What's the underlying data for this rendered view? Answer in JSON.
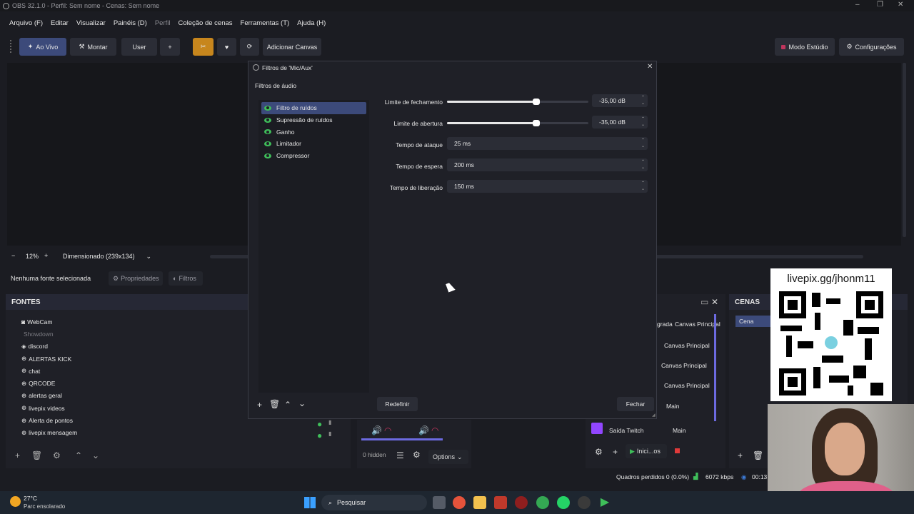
{
  "window": {
    "title": "OBS 32.1.0 - Perfil: Sem nome - Cenas: Sem nome"
  },
  "menu": [
    "Arquivo (F)",
    "Editar",
    "Visualizar",
    "Painéis (D)",
    "Perfil",
    "Coleção de cenas",
    "Ferramentas (T)",
    "Ajuda (H)"
  ],
  "toolbar": {
    "live": "Ao Vivo",
    "mount": "Montar",
    "user": "User",
    "add": "+",
    "add_canvas": "Adicionar Canvas",
    "studio_mode": "Modo Estúdio",
    "settings": "Configurações"
  },
  "zoom": {
    "minus": "−",
    "value": "12%",
    "plus": "+",
    "mode": "Dimensionado (239x134)"
  },
  "source_bar": {
    "none_selected": "Nenhuma fonte selecionada",
    "properties": "Propriedades",
    "filters": "Filtros"
  },
  "fontes": {
    "title": "FONTES",
    "items": [
      "WebCam",
      "Showdown",
      "discord",
      "ALERTAS KICK",
      "chat",
      "QRCODE",
      "alertas geral",
      "livepix videos",
      "Alerta de pontos",
      "livepix mensagem"
    ]
  },
  "dialog": {
    "title": "Filtros de 'Mic/Aux'",
    "section": "Filtros de áudio",
    "filters": [
      "Filtro de ruídos",
      "Supressão de ruídos",
      "Ganho",
      "Limitador",
      "Compressor"
    ],
    "params": {
      "close_threshold_label": "Limite de fechamento",
      "close_threshold_value": "-35,00 dB",
      "open_threshold_label": "Limite de abertura",
      "open_threshold_value": "-35,00 dB",
      "attack_label": "Tempo de ataque",
      "attack_value": "25 ms",
      "hold_label": "Tempo de espera",
      "hold_value": "200 ms",
      "release_label": "Tempo de liberação",
      "release_value": "150 ms"
    },
    "reset": "Redefinir",
    "close": "Fechar"
  },
  "canvas_list": {
    "c0": "grada",
    "c1": "Canvas Principal",
    "c2": "Canvas Principal",
    "c3": "Canvas Principal",
    "c4": "Canvas Principal",
    "main1": "Main",
    "main2": "Main",
    "twitch": "Saída Twitch",
    "start": "Inici...os"
  },
  "cenas": {
    "title": "CENAS",
    "item": "Cena"
  },
  "mixer": {
    "hidden": "0 hidden",
    "options": "Options"
  },
  "qr": {
    "url": "livepix.gg/jhonm11"
  },
  "status": {
    "dropped": "Quadros perdidos 0 (0.0%)",
    "kbps": "6072 kbps",
    "time": "00:13"
  },
  "taskbar": {
    "temp": "27°C",
    "weather": "Parc ensolarado",
    "search": "Pesquisar"
  },
  "colors": {
    "accent": "#3c4a7a",
    "orange": "#c7861d",
    "eye": "#3fbf5a",
    "twitch": "#9146ff"
  }
}
